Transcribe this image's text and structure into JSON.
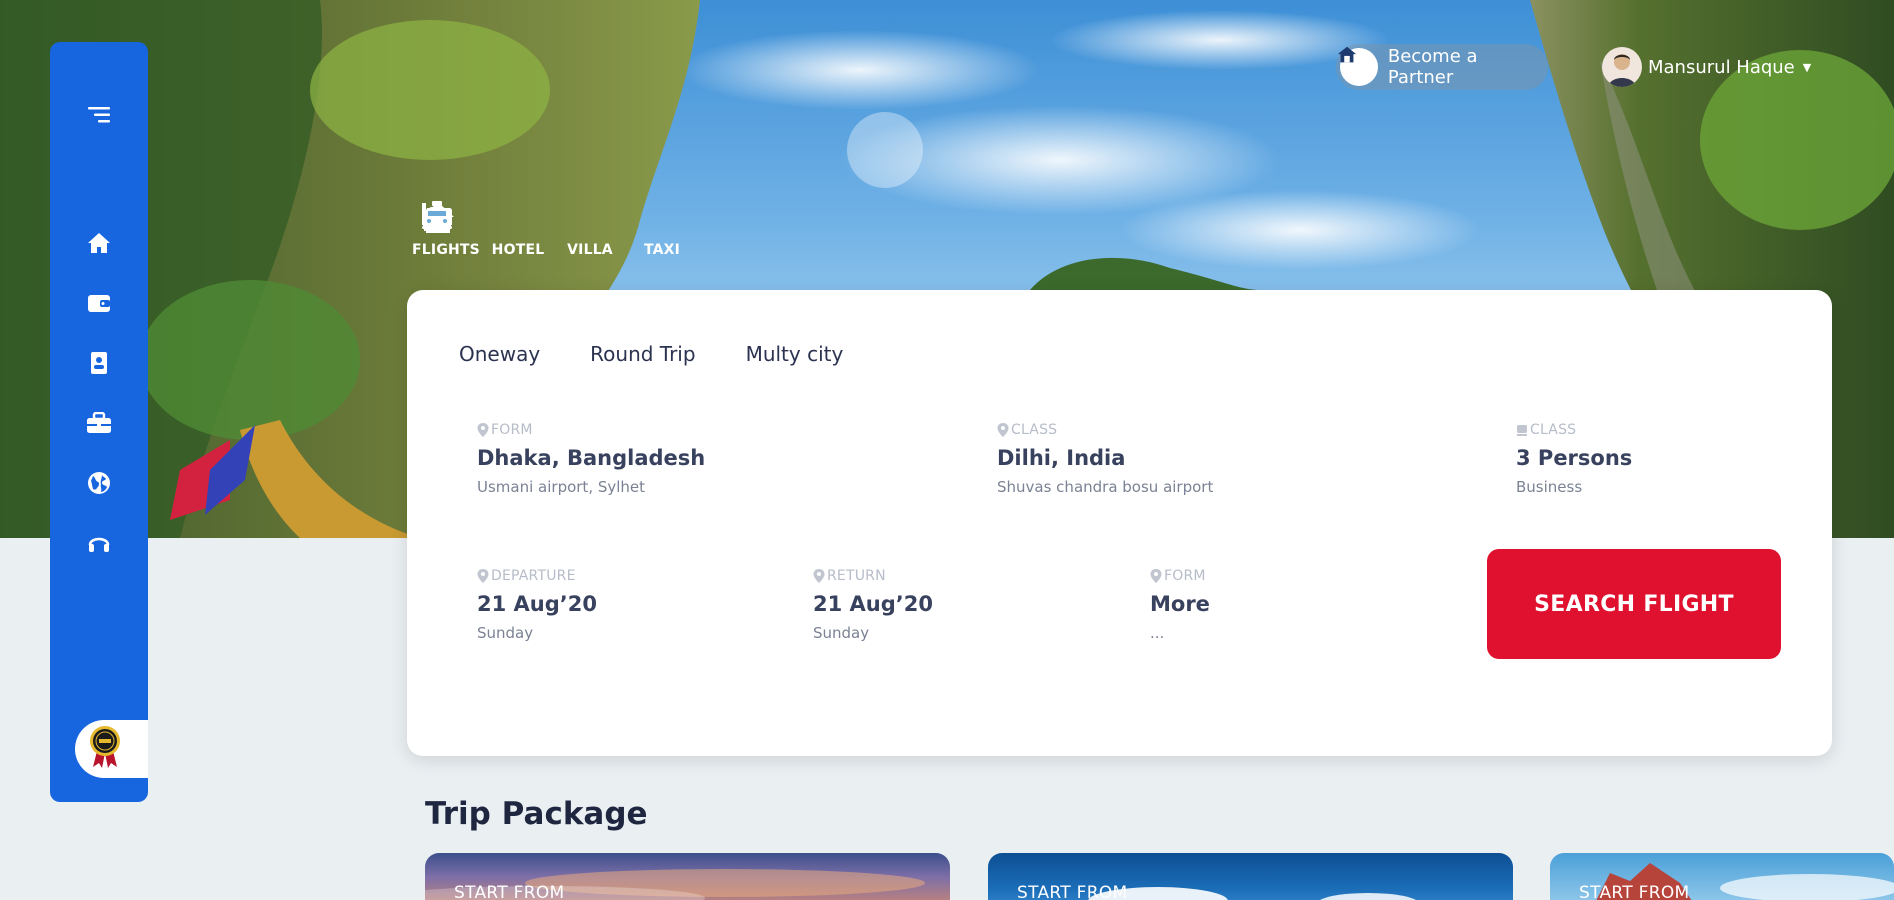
{
  "header": {
    "partner_label": "Become a Partner",
    "user_name": "Mansurul Haque",
    "user_chevron": "chevron-down-icon"
  },
  "services": [
    {
      "label": "FLIGHTS",
      "icon": "plane-departure-icon"
    },
    {
      "label": "HOTEL",
      "icon": "bed-icon"
    },
    {
      "label": "VILLA",
      "icon": "house-icon"
    },
    {
      "label": "TAXI",
      "icon": "taxi-icon"
    }
  ],
  "sidebar": {
    "items": [
      "menu-icon",
      "home-icon",
      "wallet-icon",
      "contact-card-icon",
      "briefcase-icon",
      "globe-icon",
      "headset-icon"
    ],
    "badge": "award-badge-icon"
  },
  "search": {
    "tabs": [
      "Oneway",
      "Round Trip",
      "Multy city"
    ],
    "from": {
      "caption": "FORM",
      "main": "Dhaka, Bangladesh",
      "sub": "Usmani airport, Sylhet"
    },
    "to": {
      "caption": "CLASS",
      "main": "Dilhi, India",
      "sub": "Shuvas chandra bosu airport"
    },
    "passengers": {
      "caption": "CLASS",
      "main": "3 Persons",
      "sub": "Business"
    },
    "departure": {
      "caption": "DEPARTURE",
      "main": "21 Aug’20",
      "sub": "Sunday"
    },
    "return": {
      "caption": "RETURN",
      "main": "21 Aug’20",
      "sub": "Sunday"
    },
    "more": {
      "caption": "FORM",
      "main": "More",
      "sub": "..."
    },
    "button": "SEARCH FLIGHT"
  },
  "packages": {
    "title": "Trip Package",
    "cards": [
      {
        "from_label": "START FROM"
      },
      {
        "from_label": "START FROM"
      },
      {
        "from_label": "START FROM"
      }
    ]
  },
  "colors": {
    "sidebar": "#1766e0",
    "search_button": "#e0102f",
    "page_bg": "#eaeff2"
  }
}
